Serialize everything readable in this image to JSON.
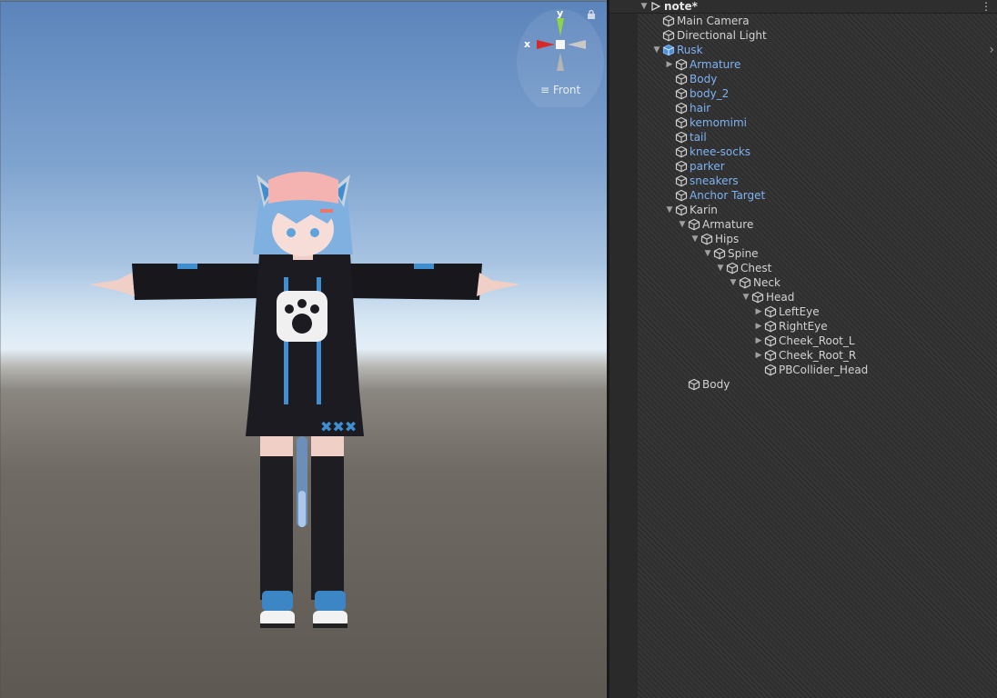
{
  "scene_view": {
    "gizmo": {
      "x_label": "x",
      "y_label": "y",
      "view_label": "Front"
    }
  },
  "hierarchy": {
    "scene_name": "note*",
    "items": [
      {
        "label": "Main Camera",
        "depth": 1,
        "arrow": "",
        "prefab": false,
        "icon": "cube-icon"
      },
      {
        "label": "Directional Light",
        "depth": 1,
        "arrow": "",
        "prefab": false,
        "icon": "cube-icon"
      },
      {
        "label": "Rusk",
        "depth": 1,
        "arrow": "▼",
        "prefab": true,
        "icon": "prefab-cube-icon"
      },
      {
        "label": "Armature",
        "depth": 2,
        "arrow": "▶",
        "prefab": true,
        "icon": "cube-icon"
      },
      {
        "label": "Body",
        "depth": 2,
        "arrow": "",
        "prefab": true,
        "icon": "cube-icon"
      },
      {
        "label": "body_2",
        "depth": 2,
        "arrow": "",
        "prefab": true,
        "icon": "cube-icon"
      },
      {
        "label": "hair",
        "depth": 2,
        "arrow": "",
        "prefab": true,
        "icon": "cube-icon"
      },
      {
        "label": "kemomimi",
        "depth": 2,
        "arrow": "",
        "prefab": true,
        "icon": "cube-icon"
      },
      {
        "label": "tail",
        "depth": 2,
        "arrow": "",
        "prefab": true,
        "icon": "cube-icon"
      },
      {
        "label": "knee-socks",
        "depth": 2,
        "arrow": "",
        "prefab": true,
        "icon": "cube-icon"
      },
      {
        "label": "parker",
        "depth": 2,
        "arrow": "",
        "prefab": true,
        "icon": "cube-icon"
      },
      {
        "label": "sneakers",
        "depth": 2,
        "arrow": "",
        "prefab": true,
        "icon": "cube-icon"
      },
      {
        "label": "Anchor Target",
        "depth": 2,
        "arrow": "",
        "prefab": true,
        "icon": "cube-icon"
      },
      {
        "label": "Karin",
        "depth": 2,
        "arrow": "▼",
        "prefab": false,
        "icon": "cube-icon"
      },
      {
        "label": "Armature",
        "depth": 3,
        "arrow": "▼",
        "prefab": false,
        "icon": "cube-icon"
      },
      {
        "label": "Hips",
        "depth": 4,
        "arrow": "▼",
        "prefab": false,
        "icon": "cube-icon"
      },
      {
        "label": "Spine",
        "depth": 5,
        "arrow": "▼",
        "prefab": false,
        "icon": "cube-icon"
      },
      {
        "label": "Chest",
        "depth": 6,
        "arrow": "▼",
        "prefab": false,
        "icon": "cube-icon"
      },
      {
        "label": "Neck",
        "depth": 7,
        "arrow": "▼",
        "prefab": false,
        "icon": "cube-icon"
      },
      {
        "label": "Head",
        "depth": 8,
        "arrow": "▼",
        "prefab": false,
        "icon": "cube-icon"
      },
      {
        "label": "LeftEye",
        "depth": 9,
        "arrow": "▶",
        "prefab": false,
        "icon": "cube-icon"
      },
      {
        "label": "RightEye",
        "depth": 9,
        "arrow": "▶",
        "prefab": false,
        "icon": "cube-icon"
      },
      {
        "label": "Cheek_Root_L",
        "depth": 9,
        "arrow": "▶",
        "prefab": false,
        "icon": "cube-icon"
      },
      {
        "label": "Cheek_Root_R",
        "depth": 9,
        "arrow": "▶",
        "prefab": false,
        "icon": "cube-icon"
      },
      {
        "label": "PBCollider_Head",
        "depth": 9,
        "arrow": "",
        "prefab": false,
        "icon": "cube-icon"
      },
      {
        "label": "Body",
        "depth": 3,
        "arrow": "",
        "prefab": false,
        "icon": "cube-icon"
      }
    ]
  },
  "colors": {
    "prefab_text": "#7eb2f2",
    "normal_text": "#d2d2d2",
    "panel_bg": "#383838"
  }
}
